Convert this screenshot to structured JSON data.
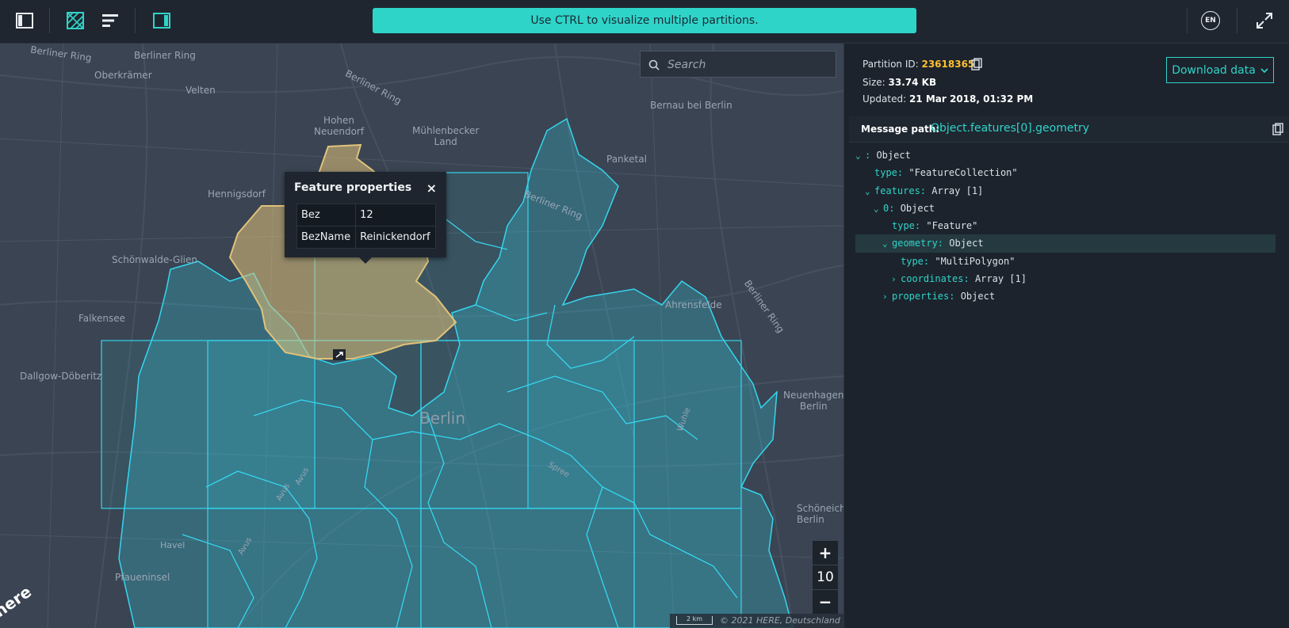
{
  "toolbar": {
    "icons": [
      "sidebar-toggle-icon",
      "partition-map-icon",
      "list-icon",
      "panel-toggle-icon"
    ],
    "banner": "Use CTRL to visualize multiple partitions.",
    "language": "EN",
    "accent_color": "#2fd4c9"
  },
  "map": {
    "search_placeholder": "Search",
    "city_label": "Berlin",
    "labels": [
      "Berliner Ring",
      "Berliner Ring",
      "Oberkrämer",
      "Velten",
      "Berliner Ring",
      "Hohen\nNeuendorf",
      "Mühlenbecker\nLand",
      "Bernau bei Berlin",
      "Panketal",
      "Hennigsdorf",
      "Berliner Ring",
      "Schönwalde-Glien",
      "Ahrensfelde",
      "Berliner Ring",
      "Falkensee",
      "Dallgow-Döberitz",
      "Neuenhagen\nBerlin",
      "Wuhle",
      "Spree",
      "Avus",
      "Avus",
      "Avus",
      "Havel",
      "Pfaueninsel",
      "Schöneich\nBerlin"
    ],
    "popup": {
      "title": "Feature properties",
      "close": "×",
      "rows": [
        {
          "key": "Bez",
          "value": "12"
        },
        {
          "key": "BezName",
          "value": "Reinickendorf"
        }
      ]
    },
    "zoom": {
      "plus": "+",
      "level": "10",
      "minus": "−"
    },
    "scale": "2 km",
    "copyright": "© 2021 HERE, Deutschland",
    "logo": "here",
    "highlight_color": "#e0c27a",
    "polygon_color": "#35d6ee"
  },
  "panel": {
    "partition_id_label": "Partition ID:",
    "partition_id": "23618365",
    "size_label": "Size:",
    "size": "33.74 KB",
    "updated_label": "Updated:",
    "updated": "21 Mar 2018, 01:32 PM",
    "download_label": "Download data",
    "message_path_label": "Message path:",
    "message_path": "Object.features[0].geometry",
    "tree": [
      {
        "chev": "⌄",
        "key": "",
        "sep": ": ",
        "value": "Object"
      },
      {
        "chev": "",
        "key": "type",
        "sep": ": ",
        "value": "\"FeatureCollection\""
      },
      {
        "chev": "⌄",
        "key": "features",
        "sep": ": ",
        "value": "Array [1]"
      },
      {
        "chev": "⌄",
        "key": "0",
        "sep": ": ",
        "value": "Object"
      },
      {
        "chev": "",
        "key": "type",
        "sep": ": ",
        "value": "\"Feature\""
      },
      {
        "chev": "⌄",
        "key": "geometry",
        "sep": ": ",
        "value": "Object"
      },
      {
        "chev": "",
        "key": "type",
        "sep": ": ",
        "value": "\"MultiPolygon\""
      },
      {
        "chev": "›",
        "key": "coordinates",
        "sep": ": ",
        "value": "Array [1]"
      },
      {
        "chev": "›",
        "key": "properties",
        "sep": ": ",
        "value": "Object"
      }
    ]
  }
}
